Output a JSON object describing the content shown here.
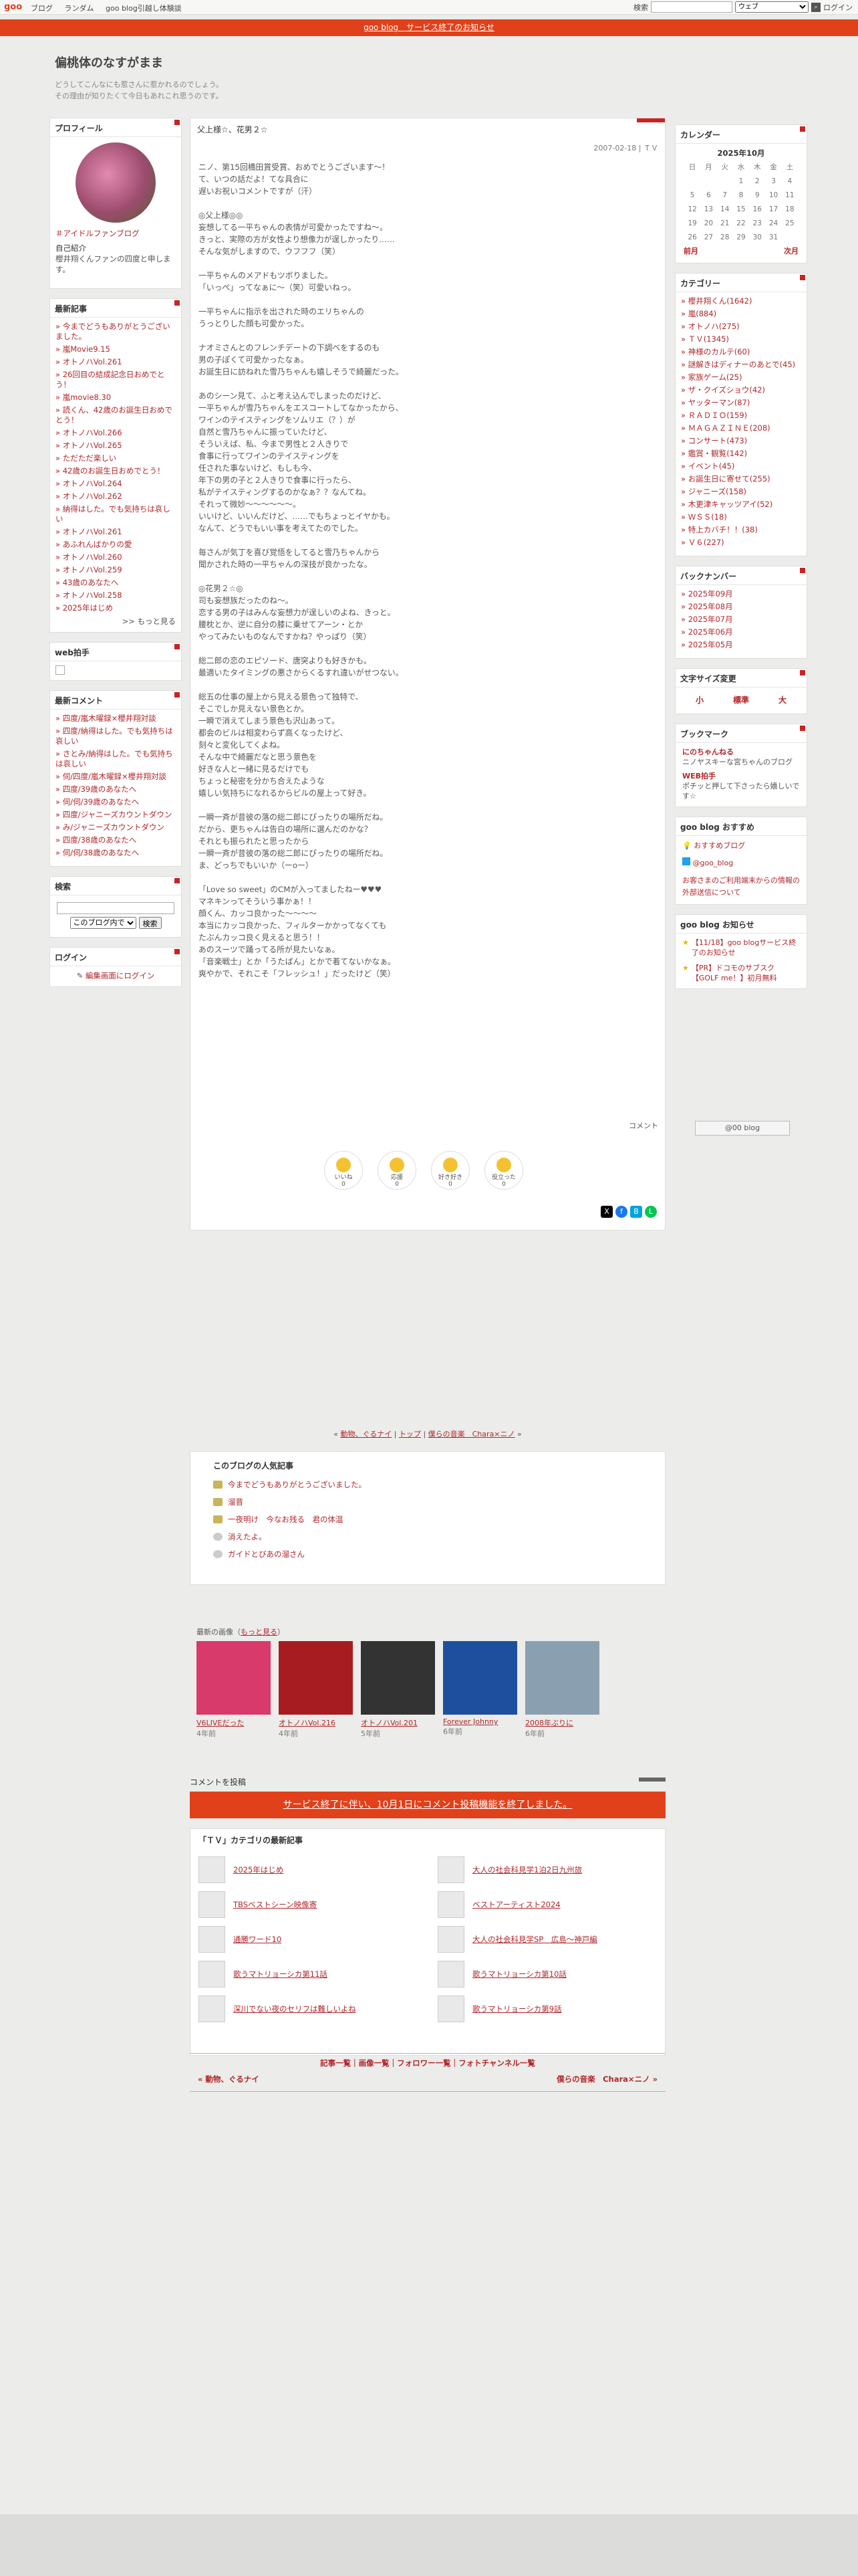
{
  "topbar": {
    "logo": "goo",
    "links": [
      "ブログ",
      "ランダム",
      "goo blog引越し体験談"
    ],
    "search_label": "検索",
    "search_option": "ウェブ",
    "login": "ログイン"
  },
  "notice": "goo blog　サービス終了のお知らせ",
  "blog": {
    "title": "偏桃体のなすがまま",
    "desc1": "どうしてこんなにも惹さんに惹かれるのでしょう。",
    "desc2": "その理由が知りたくて今日もあれこれ思うのです。"
  },
  "profile": {
    "heading": "プロフィール",
    "fan": "＃アイドルファンブログ",
    "self_label": "自己紹介",
    "self_text": "櫻井翔くんファンの四度と申します。"
  },
  "recent": {
    "heading": "最新記事",
    "items": [
      "今までどうもありがとうございました。",
      "嵐Movie9.15",
      "オトノハVol.261",
      "26回目の結成記念日おめでとう！",
      "嵐movie8.30",
      "読くん、42歳のお誕生日おめでとう！",
      "オトノハVol.266",
      "オトノハVol.265",
      "ただただ楽しい",
      "42歳のお誕生日おめでとう！",
      "オトノハVol.264",
      "オトノハVol.262",
      "納得はした。でも気持ちは哀しい",
      "オトノハVol.261",
      "あふれんばかりの愛",
      "オトノハVol.260",
      "オトノハVol.259",
      "43歳のあなたへ",
      "オトノハVol.258",
      "2025年はじめ"
    ],
    "more": ">> もっと見る"
  },
  "webclap": {
    "heading": "web拍手"
  },
  "comments": {
    "heading": "最新コメント",
    "items": [
      "四度/嵐木曜録×櫻井翔対談",
      "四度/納得はした。でも気持ちは哀しい",
      "さとみ/納得はした。でも気持ちは哀しい",
      "伺/四度/嵐木曜録×櫻井翔対談",
      "四度/39歳のあなたへ",
      "伺/伺/39歳のあなたへ",
      "四度/ジャニーズカウントダウン",
      "み/ジャニーズカウントダウン",
      "四度/38歳のあなたへ",
      "伺/伺/38歳のあなたへ"
    ]
  },
  "search": {
    "heading": "検索",
    "scope": "このブログ内で",
    "button": "検索"
  },
  "login": {
    "heading": "ログイン",
    "link": "編集画面にログイン"
  },
  "article": {
    "title": "父上様☆、花男２☆",
    "meta": "2007-02-18 | ＴＶ",
    "body": "ニノ、第15回橋田賞受賞、おめでとうございます〜！\nて、いつの話だよ！てな具合に\n遅いお祝いコメントですが（汗）\n\n◎父上様◎◎\n妄想してる一平ちゃんの表情が可愛かったですね〜。\nきっと、実際の方が女性より想像力が逞しかったり……\nそんな気がしますので、ウフフフ（笑）\n\n一平ちゃんのメアドもツボりました。\n「いっぺ」ってなぁに〜（笑）可愛いねっ。\n\n一平ちゃんに指示を出された時のエリちゃんの\nうっとりした顔も可愛かった。\n\nナオミさんとのフレンチデートの下調べをするのも\n男の子ぽくて可愛かったなぁ。\nお誕生日に訪ねれた雪乃ちゃんも嬉しそうで綺麗だった。\n\nあのシーン見て、ふと考え込んでしまったのだけど、\n一平ちゃんが雪乃ちゃんをエスコートしてなかったから、\nワインのテイスティングをソムリエ（？）が\n自然と雪乃ちゃんに振っていたけど、\nそういえば、私、今まで男性と２人きりで\n食事に行ってワインのテイスティングを\n任された事ないけど、もしも今、\n年下の男の子と２人きりで食事に行ったら、\n私がテイスティングするのかなぁ？？なんてね。\nそれって微妙〜〜〜〜〜〜。\nいいけど、いいんだけど、……でもちょっとイヤかも。\nなんて、どうでもいい事を考えてたのでした。\n\n毎さんが気丁を喜び覚悟をしてると雪乃ちゃんから\n聞かされた時の一平ちゃんの深技が良かったな。\n\n◎花男２☆◎\n司も妄想族だったのね〜。\n恋する男の子はみんな妄想力が逞しいのよね、きっと。\n腰枕とか、逆に自分の膝に乗せてアーン・とか\nやってみたいものなんですかね？やっぱり（笑）\n\n総二郎の恋のエピソード、唐突よりも好きかも。\n最適いたタイミングの悪さからくるすれ違いがせつない。\n\n総五の仕事の屋上から見える景色って独特で、\nそこでしか見えない景色とか。\n一瞬で消えてしまう景色も沢山あって。\n都会のビルは相変わらず高くなったけど、\n刻々と変化してくよね。\nそんな中で綺麗だなと思う景色を\n好きな人と一緒に見るだけでも\nちょっと秘密を分かち合えたような\n嬉しい気持ちになれるからビルの屋上って好き。\n\n一瞬一斉が昔彼の落の総二郎にぴったりの場所だね。\nだから、更ちゃんは告白の場所に選んだのかな？\nそれとも振られたと思ったから\n一瞬一斉が昔彼の落の総二郎にぴったりの場所だね。\nま、どっちでもいいか（ーoー）\n\n「Love so sweet」のCMが入ってましたねー♥♥♥\nマネキンってそういう事かぁ！！\n顔くん、カッコ良かった〜〜〜〜\n本当にカッコ良かった、フィルターかかってなくても\nたぶんカッコ良く見えると思う！！\nあのスーツで踊ってる所が見たいなぁ。\n「音楽戦士」とか「うたばん」とかで着てないかなぁ。\n爽やかで、それこそ「フレッシュ！」だったけど（笑）",
    "comment_link": "コメント",
    "reactions": [
      {
        "label": "いいね",
        "count": "0"
      },
      {
        "label": "応援",
        "count": "0"
      },
      {
        "label": "好き好き",
        "count": "0"
      },
      {
        "label": "役立った",
        "count": "0"
      }
    ]
  },
  "calendar": {
    "heading": "カレンダー",
    "month": "2025年10月",
    "days": [
      "日",
      "月",
      "火",
      "水",
      "木",
      "金",
      "土"
    ],
    "weeks": [
      [
        "",
        "",
        "",
        "1",
        "2",
        "3",
        "4"
      ],
      [
        "5",
        "6",
        "7",
        "8",
        "9",
        "10",
        "11"
      ],
      [
        "12",
        "13",
        "14",
        "15",
        "16",
        "17",
        "18"
      ],
      [
        "19",
        "20",
        "21",
        "22",
        "23",
        "24",
        "25"
      ],
      [
        "26",
        "27",
        "28",
        "29",
        "30",
        "31",
        ""
      ]
    ],
    "prev": "前月",
    "next": "次月"
  },
  "category": {
    "heading": "カテゴリー",
    "items": [
      "櫻井翔くん(1642)",
      "嵐(884)",
      "オトノハ(275)",
      "ＴＶ(1345)",
      "神様のカルテ(60)",
      "謎解きはディナーのあとで(45)",
      "家族ゲーム(25)",
      "ザ・クイズショウ(42)",
      "ヤッターマン(87)",
      "ＲＡＤＩＯ(159)",
      "ＭＡＧＡＺＩＮＥ(208)",
      "コンサート(473)",
      "鑑賞・観覧(142)",
      "イベント(45)",
      "お誕生日に寄せて(255)",
      "ジャニーズ(158)",
      "木更津キャッツアイ(52)",
      "ＷＳＳ(18)",
      "特上カバチ！！(38)",
      "Ｖ６(227)"
    ]
  },
  "backnumber": {
    "heading": "バックナンバー",
    "items": [
      "2025年09月",
      "2025年08月",
      "2025年07月",
      "2025年06月",
      "2025年05月"
    ]
  },
  "fontsize": {
    "heading": "文字サイズ変更",
    "small": "小",
    "normal": "標準",
    "large": "大"
  },
  "bookmark": {
    "heading": "ブックマーク",
    "items": [
      {
        "title": "にのちゃんねる",
        "desc": "ニノヤスキーな宮ちゃんのブログ"
      },
      {
        "title": "WEB拍手",
        "desc": "ポチッと押して下さったら嬉しいです☆"
      }
    ]
  },
  "goorec": {
    "heading": "goo blog おすすめ",
    "items": [
      "おすすめブログ",
      "@goo_blog"
    ],
    "warn": "お客さまのご利用端末からの情報の外部送信について"
  },
  "goonews": {
    "heading": "goo blog お知らせ",
    "items": [
      "【11/18】goo blogサービス終了のお知らせ",
      "【PR】ドコモのサブスク【GOLF me！】初月無料"
    ]
  },
  "gotop": "@00 blog",
  "pager": {
    "prev": "動物、ぐるナイ",
    "top": "トップ",
    "next": "僕らの音楽　Chara×ニノ"
  },
  "popular": {
    "heading": "このブログの人気記事",
    "items": [
      "今までどうもありがとうございました。",
      "溜晋",
      "一夜明け　今なお残る　君の体温",
      "消えたよ。",
      "ガイドとびあの溜さん"
    ]
  },
  "images": {
    "heading": "最新の画像",
    "more": "もっと見る",
    "items": [
      {
        "caption": "V6LIVEだった",
        "ago": "4年前",
        "color": "#d83a6b"
      },
      {
        "caption": "オトノハVol.216",
        "ago": "4年前",
        "color": "#a61c20"
      },
      {
        "caption": "オトノハVol.201",
        "ago": "5年前",
        "color": "#333333"
      },
      {
        "caption": "Forever Johnny",
        "ago": "6年前",
        "color": "#1d4f9e"
      },
      {
        "caption": "2008年ぶりに",
        "ago": "6年前",
        "color": "#8aa0b0"
      }
    ]
  },
  "comment_post": {
    "label": "コメントを投稿",
    "closed": "サービス終了に伴い、10月1日にコメント投稿機能を終了しました。"
  },
  "tvcat": {
    "heading": "「ＴＶ」カテゴリの最新記事",
    "items": [
      "2025年はじめ",
      "大人の社会科見学1泊2日九州旅",
      "TBSベストシーン映像寄",
      "ベストアーティスト2024",
      "通勝ワード10",
      "大人の社会科見学SP　広島〜神戸編",
      "歌うマトリョーシカ第11話",
      "歌うマトリョーシカ第10話",
      "深川でない夜のセリフは難しいよね",
      "歌うマトリョーシカ第9話"
    ]
  },
  "bottomnav": {
    "links": "記事一覧｜画像一覧｜フォロワー一覧｜フォトチャンネル一覧",
    "prev": "« 動物、ぐるナイ",
    "next": "僕らの音楽　Chara×ニノ »"
  }
}
